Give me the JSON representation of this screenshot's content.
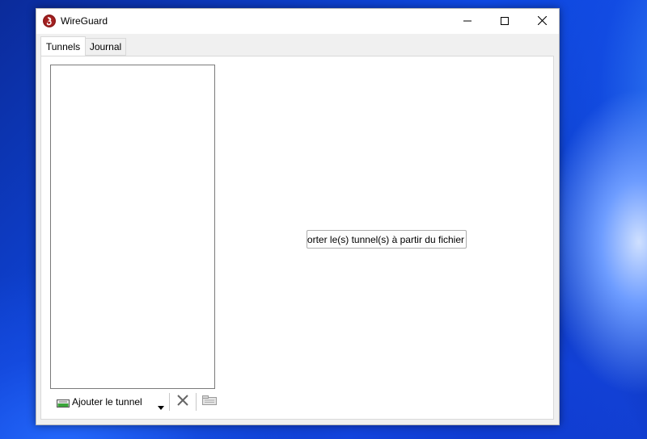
{
  "window": {
    "title": "WireGuard",
    "app_icon": "wireguard-logo-icon",
    "controls": [
      "minimize-icon",
      "maximize-icon",
      "close-icon"
    ]
  },
  "tabs": [
    {
      "label": "Tunnels",
      "selected": true
    },
    {
      "label": "Journal",
      "selected": false
    }
  ],
  "toolbar": {
    "add_tunnel_label": "Ajouter le tunnel",
    "icons": [
      "add-tunnel-icon",
      "chevron-down-icon",
      "delete-icon",
      "export-icon"
    ]
  },
  "main": {
    "import_button_label": "Importer le(s) tunnel(s) à partir du fichier"
  },
  "colors": {
    "accent_red": "#8b1a1a",
    "add_icon_green": "#3aa53a"
  }
}
